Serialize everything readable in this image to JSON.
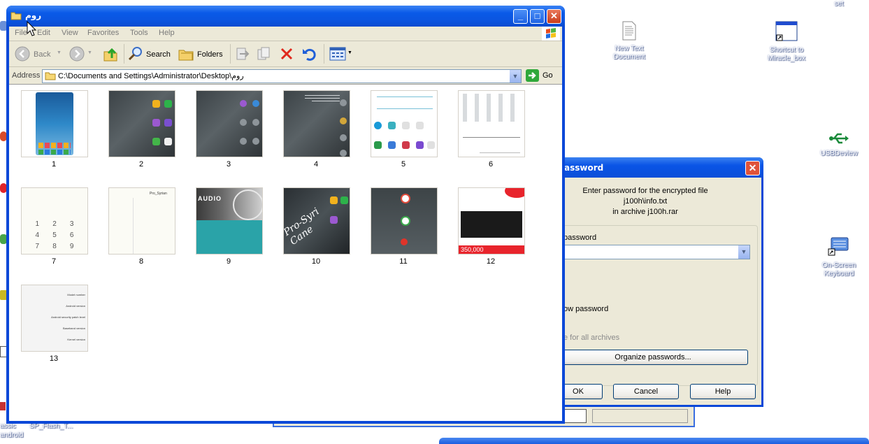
{
  "desktop": {
    "icons": [
      {
        "label": "New Text\nDocument"
      },
      {
        "label": "Shortcut to\nMiracle_box"
      },
      {
        "label": "USBDeview"
      },
      {
        "label": "On-Screen\nKeyboard"
      }
    ],
    "partial_top_label": "set",
    "bottom_left_labels": [
      "assic",
      "android",
      "SP_Flash_T..."
    ]
  },
  "explorer": {
    "title": "روم",
    "menu": [
      "File",
      "Edit",
      "View",
      "Favorites",
      "Tools",
      "Help"
    ],
    "toolbar": {
      "back": "Back",
      "search": "Search",
      "folders": "Folders"
    },
    "address_label": "Address",
    "address_value": "C:\\Documents and Settings\\Administrator\\Desktop\\روم",
    "go_label": "Go",
    "thumbnails": [
      "1",
      "2",
      "3",
      "4",
      "5",
      "6",
      "7",
      "8",
      "9",
      "10",
      "11",
      "12",
      "13"
    ]
  },
  "dialog": {
    "title": "assword",
    "message_line1": "Enter password for the encrypted file",
    "message_line2": "j100h\\info.txt",
    "message_line3": "in archive j100h.rar",
    "password_label": "password",
    "show_password_label": "ow password",
    "use_for_all_label": "e for all archives",
    "organize_button": "Organize passwords...",
    "ok_button": "OK",
    "cancel_button": "Cancel",
    "help_button": "Help"
  },
  "thumb_text": {
    "t8_title": "Pro_Syrian",
    "t9_audio": "AUDIO",
    "t10_script": "Pro-Syri Cane",
    "t12_price": "350,000",
    "t13_lines": [
      "Model number",
      "Android version",
      "Android security patch level",
      "Baseband version",
      "Kernel version"
    ],
    "dial_digits": [
      "1",
      "2",
      "3",
      "4",
      "5",
      "6",
      "7",
      "8",
      "9"
    ]
  },
  "colors": {
    "xp_blue": "#0a48d8",
    "xp_title": "#0b55e0",
    "face": "#ece9d8"
  }
}
